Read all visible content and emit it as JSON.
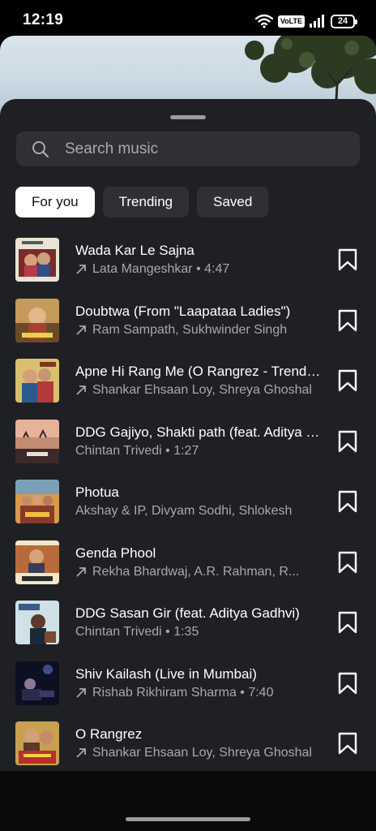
{
  "status_bar": {
    "time": "12:19",
    "volte": "VoLTE",
    "battery": "24"
  },
  "search": {
    "placeholder": "Search music"
  },
  "tabs": [
    {
      "label": "For you",
      "active": true
    },
    {
      "label": "Trending",
      "active": false
    },
    {
      "label": "Saved",
      "active": false
    }
  ],
  "songs": [
    {
      "title": "Wada Kar Le Sajna",
      "subtitle": "Lata Mangeshkar • 4:47",
      "trending": true
    },
    {
      "title": "Doubtwa (From \"Laapataa Ladies\")",
      "subtitle": "Ram Sampath, Sukhwinder Singh",
      "trending": true
    },
    {
      "title": "Apne Hi Rang Me (O Rangrez - Trending)",
      "subtitle": "Shankar Ehsaan Loy, Shreya Ghoshal",
      "trending": true
    },
    {
      "title": "DDG Gajiyo, Shakti path (feat. Aditya Gadhvi)",
      "subtitle": "Chintan Trivedi • 1:27",
      "trending": false
    },
    {
      "title": "Photua",
      "subtitle": "Akshay & IP, Divyam Sodhi, Shlokesh",
      "trending": false
    },
    {
      "title": "Genda Phool",
      "subtitle": "Rekha Bhardwaj, A.R. Rahman, R...",
      "trending": true
    },
    {
      "title": "DDG Sasan Gir (feat. Aditya Gadhvi)",
      "subtitle": "Chintan Trivedi • 1:35",
      "trending": false
    },
    {
      "title": "Shiv Kailash (Live in Mumbai)",
      "subtitle": "Rishab Rikhiram Sharma • 7:40",
      "trending": true
    },
    {
      "title": "O Rangrez",
      "subtitle": "Shankar Ehsaan Loy, Shreya Ghoshal",
      "trending": true
    }
  ],
  "icons": {
    "search": "search-icon",
    "trending": "trending-arrow-icon",
    "bookmark": "bookmark-icon"
  },
  "colors": {
    "sheet": "#1f2024",
    "chip_active": "#ffffff",
    "chip": "#2f3036",
    "subtitle": "#a7a8ae"
  }
}
